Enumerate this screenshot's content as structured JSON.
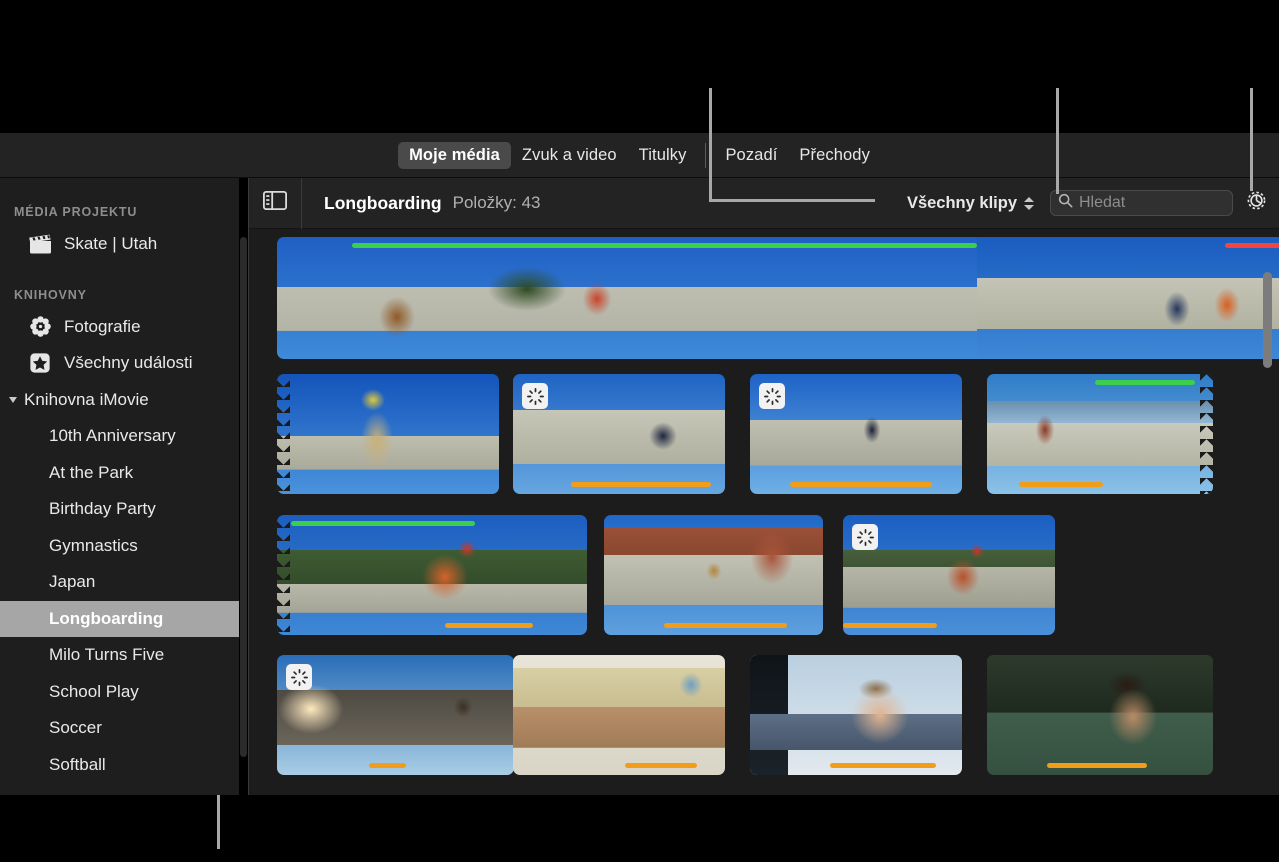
{
  "app": {
    "name": "iMovie",
    "theme": "dark"
  },
  "tabs": {
    "items": [
      {
        "label": "Moje média",
        "active": true
      },
      {
        "label": "Zvuk a video",
        "active": false
      },
      {
        "label": "Titulky",
        "active": false
      },
      {
        "label": "Pozadí",
        "active": false
      },
      {
        "label": "Přechody",
        "active": false
      }
    ]
  },
  "sidebar": {
    "sections": [
      {
        "header": "MÉDIA PROJEKTU",
        "items": [
          {
            "label": "Skate | Utah",
            "icon": "clapperboard-icon",
            "selected": false
          }
        ]
      },
      {
        "header": "KNIHOVNY",
        "items": [
          {
            "label": "Fotografie",
            "icon": "photos-flower-icon",
            "selected": false
          },
          {
            "label": "Všechny události",
            "icon": "star-square-icon",
            "selected": false
          }
        ]
      }
    ],
    "library": {
      "label": "Knihovna iMovie",
      "expanded": true,
      "events": [
        {
          "label": "10th Anniversary",
          "selected": false
        },
        {
          "label": "At the Park",
          "selected": false
        },
        {
          "label": "Birthday Party",
          "selected": false
        },
        {
          "label": "Gymnastics",
          "selected": false
        },
        {
          "label": "Japan",
          "selected": false
        },
        {
          "label": "Longboarding",
          "selected": true
        },
        {
          "label": "Milo Turns Five",
          "selected": false
        },
        {
          "label": "School Play",
          "selected": false
        },
        {
          "label": "Soccer",
          "selected": false
        },
        {
          "label": "Softball",
          "selected": false
        }
      ]
    }
  },
  "toolbar": {
    "sidebar_toggle_icon": "sidebar-toggle-icon",
    "title": "Longboarding",
    "count_label": "Položky: 43",
    "filter_popup": {
      "value": "Všechny klipy",
      "icon": "stepper-updown-icon"
    },
    "search": {
      "placeholder": "Hledat",
      "value": "",
      "icon": "search-icon"
    },
    "settings_icon": "gear-icon"
  },
  "colors": {
    "favorite_bar": "#3ccf4e",
    "rejected_bar": "#f2453d",
    "keyword_bar": "#f29d19",
    "selection": "#a6a6a6",
    "toolbar_bg": "#232323",
    "browser_bg": "#1c1c1c",
    "sidebar_bg": "#1e1e1e"
  },
  "browser": {
    "scroll_position": "near-top",
    "clips": [
      {
        "name": "clip-row1-a",
        "badges": [
          "favorite"
        ],
        "spinner": false
      },
      {
        "name": "clip-row1-b",
        "badges": [
          "rejected"
        ],
        "spinner": false
      },
      {
        "name": "clip-row2-a",
        "badges": [],
        "spinner": false
      },
      {
        "name": "clip-row2-b",
        "badges": [
          "keyword"
        ],
        "spinner": true
      },
      {
        "name": "clip-row2-c",
        "badges": [
          "keyword"
        ],
        "spinner": true
      },
      {
        "name": "clip-row2-d",
        "badges": [
          "favorite",
          "keyword"
        ],
        "spinner": false
      },
      {
        "name": "clip-row3-a",
        "badges": [
          "favorite",
          "keyword"
        ],
        "spinner": false
      },
      {
        "name": "clip-row3-b",
        "badges": [
          "keyword"
        ],
        "spinner": false
      },
      {
        "name": "clip-row3-c",
        "badges": [
          "keyword"
        ],
        "spinner": true
      },
      {
        "name": "clip-row4-a",
        "badges": [
          "keyword"
        ],
        "spinner": true
      },
      {
        "name": "clip-row4-b",
        "badges": [
          "keyword"
        ],
        "spinner": false
      },
      {
        "name": "clip-row4-c",
        "badges": [
          "keyword"
        ],
        "spinner": false
      },
      {
        "name": "clip-row4-d",
        "badges": [
          "keyword"
        ],
        "spinner": false
      }
    ]
  },
  "callouts": {
    "count": 4,
    "targets": [
      "filter-popup",
      "search-field",
      "settings-gear",
      "sidebar"
    ]
  }
}
